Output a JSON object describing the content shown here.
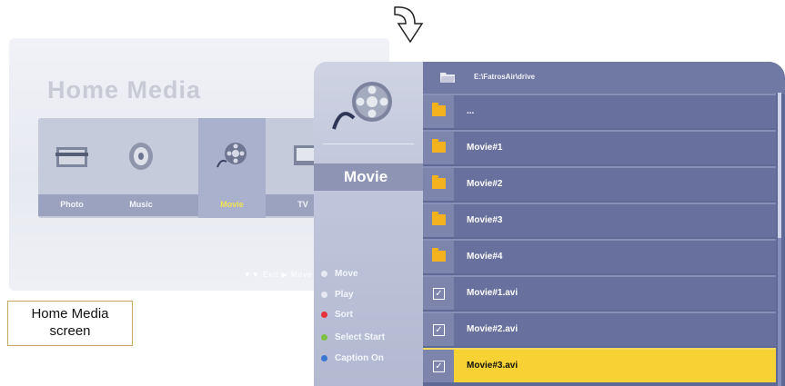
{
  "home_screen": {
    "title": "Home Media",
    "items": [
      {
        "label": "Photo",
        "icon": "photo-icon"
      },
      {
        "label": "Music",
        "icon": "speaker-icon"
      },
      {
        "label": "Movie",
        "icon": "film-reel-icon",
        "active": true
      },
      {
        "label": "TV",
        "icon": "tv-icon"
      }
    ],
    "hint": "▼▼  Exit  ▶ Move"
  },
  "caption": {
    "line1": "Home Media",
    "line2": "screen"
  },
  "movie_panel": {
    "section_label": "Movie",
    "path": "E:\\FatrosAir\\drive",
    "legend": [
      {
        "label": "Move",
        "color": "#e6e8f2"
      },
      {
        "label": "Play",
        "color": "#e6e8f2"
      },
      {
        "label": "Sort",
        "color": "#e5323a"
      },
      {
        "label": "Select Start",
        "color": "#7dc142"
      },
      {
        "label": "Caption On",
        "color": "#3a78d2"
      }
    ],
    "rows": [
      {
        "type": "up",
        "name": "..."
      },
      {
        "type": "folder",
        "name": "Movie#1"
      },
      {
        "type": "folder",
        "name": "Movie#2"
      },
      {
        "type": "folder",
        "name": "Movie#3"
      },
      {
        "type": "folder",
        "name": "Movie#4"
      },
      {
        "type": "file",
        "name": "Movie#1.avi"
      },
      {
        "type": "file",
        "name": "Movie#2.avi"
      },
      {
        "type": "file",
        "name": "Movie#3.avi",
        "selected": true
      }
    ]
  },
  "colors": {
    "accent": "#f6d235",
    "panel": "#5f6995",
    "folder": "#f3b21e"
  }
}
